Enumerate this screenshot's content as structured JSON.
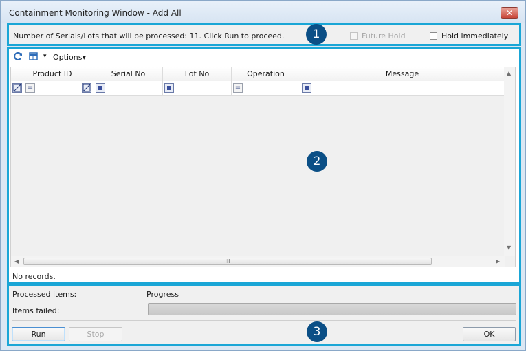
{
  "window": {
    "title": "Containment Monitoring Window - Add All",
    "close_glyph": "✕"
  },
  "panel1": {
    "message": "Number of Serials/Lots that will be processed: 11. Click Run to proceed.",
    "future_hold": {
      "label": "Future Hold",
      "checked": false,
      "enabled": false
    },
    "hold_immediately": {
      "label": "Hold immediately",
      "checked": false,
      "enabled": true
    },
    "badge": "1"
  },
  "panel2": {
    "toolbar": {
      "refresh_icon": "refresh-icon",
      "layout_icon": "grid-layout-icon",
      "dropdown_glyph": "▾",
      "options_label": "Options▾"
    },
    "columns": [
      "Product ID",
      "Serial No",
      "Lot No",
      "Operation",
      "Message"
    ],
    "filter_ops": {
      "eq": "="
    },
    "scroll_thumb_glyph": "III",
    "status": "No records.",
    "badge": "2"
  },
  "panel3": {
    "processed_label": "Processed items:",
    "progress_label": "Progress",
    "failed_label": "Items failed:",
    "progress_value": 0,
    "run_label": "Run",
    "stop_label": "Stop",
    "ok_label": "OK",
    "badge": "3"
  },
  "colors": {
    "accent_border": "#1aa6d6",
    "badge": "#0b4f86"
  }
}
